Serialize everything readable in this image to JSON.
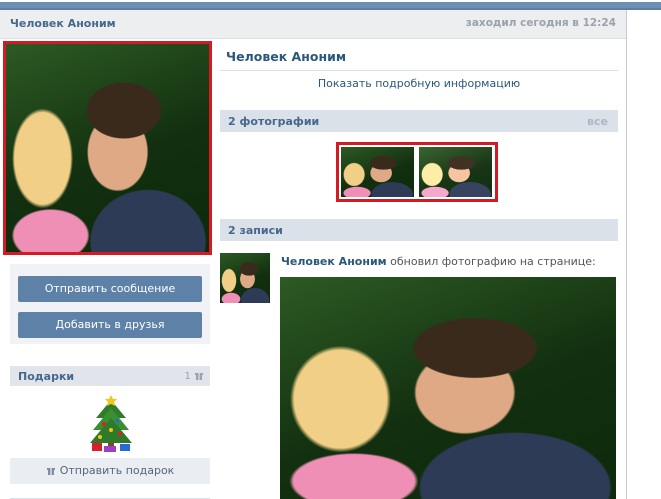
{
  "header": {
    "name": "Человек Аноним",
    "last_seen": "заходил сегодня в 12:24"
  },
  "profile": {
    "name": "Человек Аноним",
    "show_info_link": "Показать подробную информацию"
  },
  "actions": {
    "send_message": "Отправить сообщение",
    "add_friend": "Добавить в друзья"
  },
  "gifts": {
    "title": "Подарки",
    "count": "1",
    "send_gift": "Отправить подарок"
  },
  "photos_section": {
    "title": "2 фотографии",
    "all_link": "все"
  },
  "posts_section": {
    "title": "2 записи"
  },
  "post": {
    "author": "Человек Аноним",
    "action": "обновил фотографию на странице:"
  },
  "colors": {
    "link_blue": "#2b587a",
    "button_blue": "#5e81a8",
    "highlight_red": "#d41b24",
    "section_gray": "#dae1e8"
  }
}
